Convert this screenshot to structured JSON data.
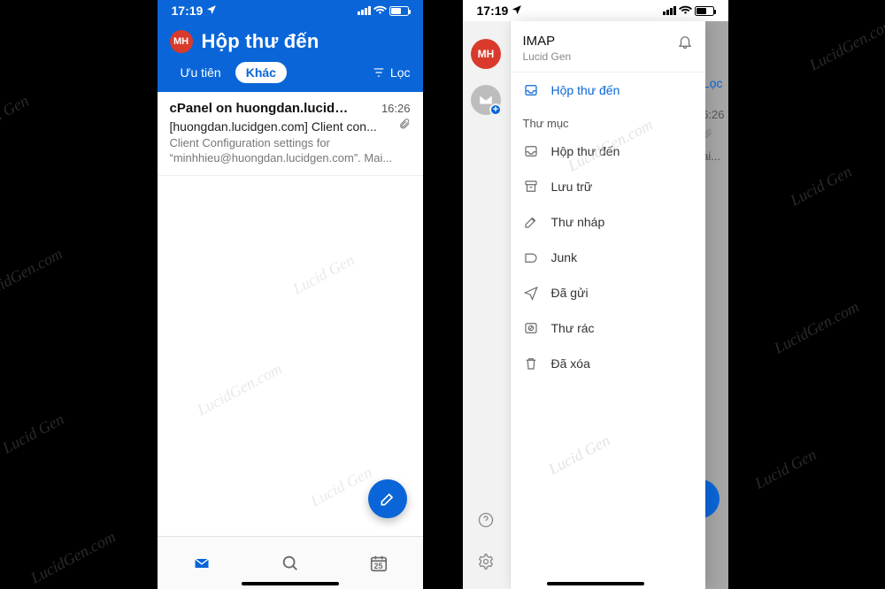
{
  "watermark": "Lucid Gen",
  "watermark_domain": "LucidGen.com",
  "status": {
    "time": "17:19"
  },
  "phone1": {
    "avatar_initials": "MH",
    "title": "Hộp thư đến",
    "tabs": {
      "focused": "Ưu tiên",
      "other": "Khác"
    },
    "filter_label": "Lọc",
    "message": {
      "sender": "cPanel on huongdan.lucidgen.c...",
      "time": "16:26",
      "subject": "[huongdan.lucidgen.com] Client con...",
      "preview": "Client Configuration settings for “minhhieu@huongdan.lucidgen.com”. Mai..."
    },
    "bottom": {
      "calendar_day": "25"
    }
  },
  "phone2": {
    "peek": {
      "filter": "Lọc",
      "time": "6:26",
      "preview_tail": "ai..."
    },
    "rail": {
      "avatar_initials": "MH",
      "plus": "+"
    },
    "account": {
      "type": "IMAP",
      "name": "Lucid Gen"
    },
    "selected_inbox": "Hộp thư đến",
    "folders_label": "Thư mục",
    "folders": {
      "inbox": "Hộp thư đến",
      "archive": "Lưu trữ",
      "drafts": "Thư nháp",
      "junk": "Junk",
      "sent": "Đã gửi",
      "spam": "Thư rác",
      "deleted": "Đã xóa"
    }
  }
}
